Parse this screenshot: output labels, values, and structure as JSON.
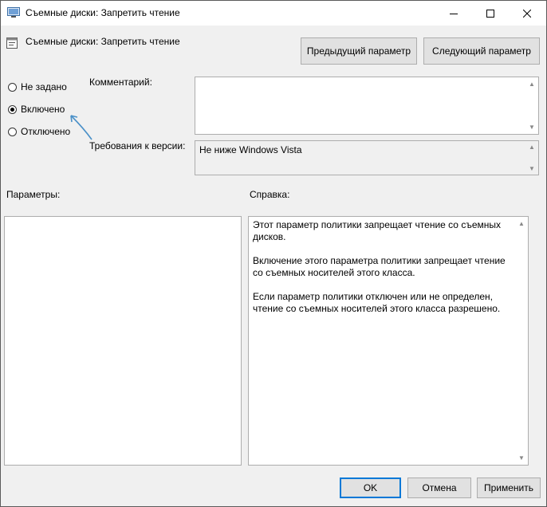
{
  "window": {
    "title": "Съемные диски: Запретить чтение"
  },
  "policy": {
    "name": "Съемные диски: Запретить чтение"
  },
  "nav": {
    "prev_label": "Предыдущий параметр",
    "next_label": "Следующий параметр"
  },
  "state": {
    "options": [
      {
        "label": "Не задано",
        "checked": false
      },
      {
        "label": "Включено",
        "checked": true
      },
      {
        "label": "Отключено",
        "checked": false
      }
    ]
  },
  "comment": {
    "label": "Комментарий:",
    "value": ""
  },
  "version": {
    "label": "Требования к версии:",
    "value": "Не ниже Windows Vista"
  },
  "params": {
    "label": "Параметры:"
  },
  "help": {
    "label": "Справка:",
    "paragraphs": [
      "Этот параметр политики запрещает чтение со съемных дисков.",
      "Включение этого параметра политики запрещает чтение со съемных носителей этого класса.",
      "Если параметр политики отключен или не определен, чтение со съемных носителей этого класса разрешено."
    ]
  },
  "footer": {
    "ok_label": "OK",
    "cancel_label": "Отмена",
    "apply_label": "Применить"
  },
  "colors": {
    "accent": "#0078d7",
    "annotation_arrow": "#4a90c8"
  }
}
